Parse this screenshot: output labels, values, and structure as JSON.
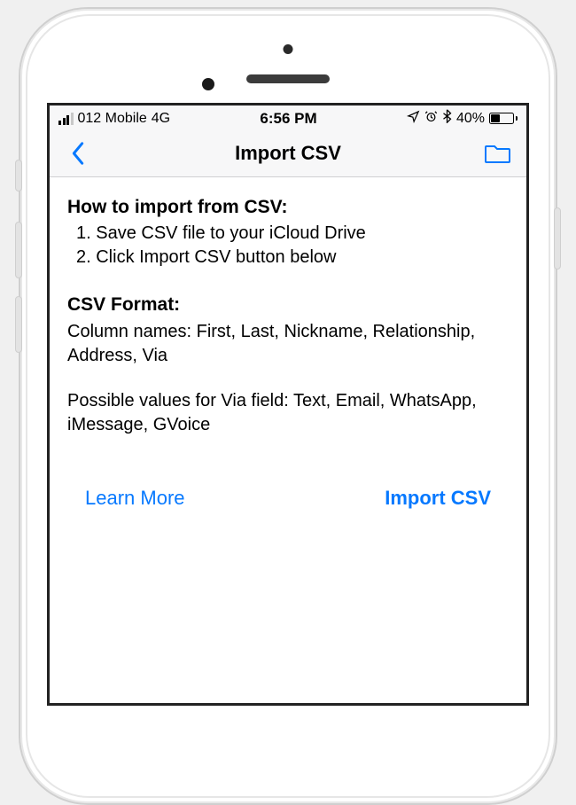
{
  "status": {
    "carrier": "012 Mobile",
    "network": "4G",
    "time": "6:56 PM",
    "icons": {
      "location": "location-arrow-icon",
      "alarm": "alarm-icon",
      "bluetooth": "bluetooth-icon"
    },
    "battery_pct": "40%"
  },
  "nav": {
    "title": "Import CSV"
  },
  "body": {
    "howto_heading": "How to import from CSV:",
    "steps": [
      "1. Save CSV file to your iCloud Drive",
      "2. Click Import CSV button below"
    ],
    "format_heading": "CSV Format:",
    "format_columns": "Column names: First, Last, Nickname, Relationship, Address, Via",
    "format_via": "Possible values for Via field: Text, Email, WhatsApp, iMessage, GVoice"
  },
  "actions": {
    "learn_more": "Learn More",
    "import": "Import CSV"
  }
}
